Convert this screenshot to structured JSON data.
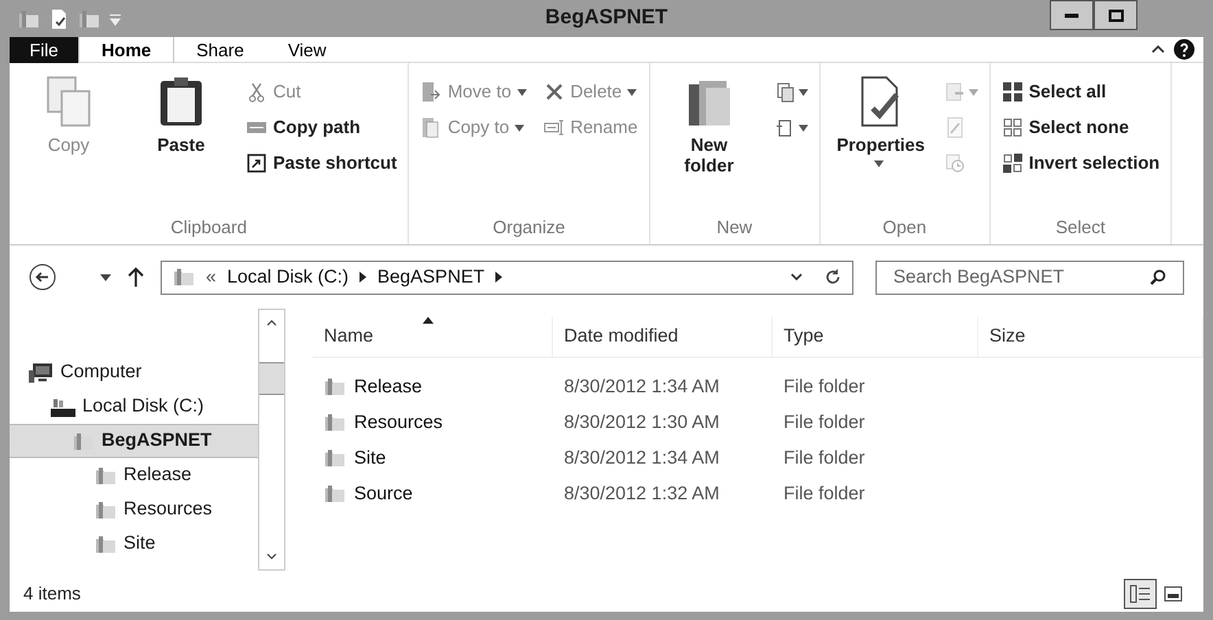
{
  "window": {
    "title": "BegASPNET"
  },
  "ribbon": {
    "tabs": [
      {
        "label": "File",
        "kind": "file",
        "selected": false
      },
      {
        "label": "Home",
        "kind": "tab",
        "selected": true
      },
      {
        "label": "Share",
        "kind": "tab",
        "selected": false
      },
      {
        "label": "View",
        "kind": "tab",
        "selected": false
      }
    ],
    "groups": [
      {
        "label": "Clipboard",
        "columns": [
          {
            "items": [
              {
                "kind": "large",
                "label": "Copy",
                "disabled": true
              }
            ]
          },
          {
            "items": [
              {
                "kind": "large",
                "label": "Paste",
                "disabled": false
              }
            ]
          },
          {
            "items": [
              {
                "kind": "small",
                "label": "Cut",
                "disabled": true
              },
              {
                "kind": "small",
                "label": "Copy path",
                "disabled": false
              },
              {
                "kind": "small",
                "label": "Paste shortcut",
                "disabled": false
              }
            ]
          }
        ]
      },
      {
        "label": "Organize",
        "columns": [
          {
            "items": [
              {
                "kind": "small",
                "label": "Move to",
                "disabled": true,
                "dropdown": true
              },
              {
                "kind": "small",
                "label": "Copy to",
                "disabled": true,
                "dropdown": true
              }
            ]
          },
          {
            "items": [
              {
                "kind": "small",
                "label": "Delete",
                "disabled": true,
                "dropdown": true
              },
              {
                "kind": "small",
                "label": "Rename",
                "disabled": true
              }
            ]
          }
        ]
      },
      {
        "label": "New",
        "columns": [
          {
            "items": [
              {
                "kind": "large",
                "label": "New folder",
                "disabled": false
              }
            ]
          },
          {
            "items": [
              {
                "kind": "icon",
                "disabled": false,
                "dropdown": true
              },
              {
                "kind": "icon",
                "disabled": false,
                "dropdown": true
              }
            ]
          }
        ]
      },
      {
        "label": "Open",
        "columns": [
          {
            "items": [
              {
                "kind": "large",
                "label": "Properties",
                "disabled": false,
                "dropdown": true
              }
            ]
          },
          {
            "items": [
              {
                "kind": "icon",
                "disabled": true,
                "dropdown": true
              },
              {
                "kind": "icon",
                "disabled": true
              },
              {
                "kind": "icon",
                "disabled": true
              }
            ]
          }
        ]
      },
      {
        "label": "Select",
        "columns": [
          {
            "items": [
              {
                "kind": "small",
                "label": "Select all",
                "disabled": false
              },
              {
                "kind": "small",
                "label": "Select none",
                "disabled": false
              },
              {
                "kind": "small",
                "label": "Invert selection",
                "disabled": false
              }
            ]
          }
        ]
      }
    ]
  },
  "address": {
    "overflow": "«",
    "crumbs": [
      "Local Disk (C:)",
      "BegASPNET"
    ]
  },
  "search": {
    "placeholder": "Search BegASPNET"
  },
  "navigation": [
    {
      "label": "Computer",
      "kind": "computer",
      "selected": false,
      "children": [
        {
          "label": "Local Disk (C:)",
          "kind": "drive",
          "selected": false,
          "children": [
            {
              "label": "BegASPNET",
              "kind": "folder",
              "selected": true,
              "children": [
                {
                  "label": "Release",
                  "kind": "folder",
                  "selected": false
                },
                {
                  "label": "Resources",
                  "kind": "folder",
                  "selected": false
                },
                {
                  "label": "Site",
                  "kind": "folder",
                  "selected": false
                }
              ]
            }
          ]
        }
      ]
    }
  ],
  "table": {
    "columns": [
      "Name",
      "Date modified",
      "Type",
      "Size"
    ],
    "rows": [
      {
        "name": "Release",
        "date": "8/30/2012 1:34 AM",
        "type": "File folder"
      },
      {
        "name": "Resources",
        "date": "8/30/2012 1:30 AM",
        "type": "File folder"
      },
      {
        "name": "Site",
        "date": "8/30/2012 1:34 AM",
        "type": "File folder"
      },
      {
        "name": "Source",
        "date": "8/30/2012 1:32 AM",
        "type": "File folder"
      }
    ]
  },
  "status_bar": {
    "text": "4 items",
    "views": [
      {
        "kind": "details",
        "selected": true
      },
      {
        "kind": "large_icons",
        "selected": false
      }
    ]
  }
}
